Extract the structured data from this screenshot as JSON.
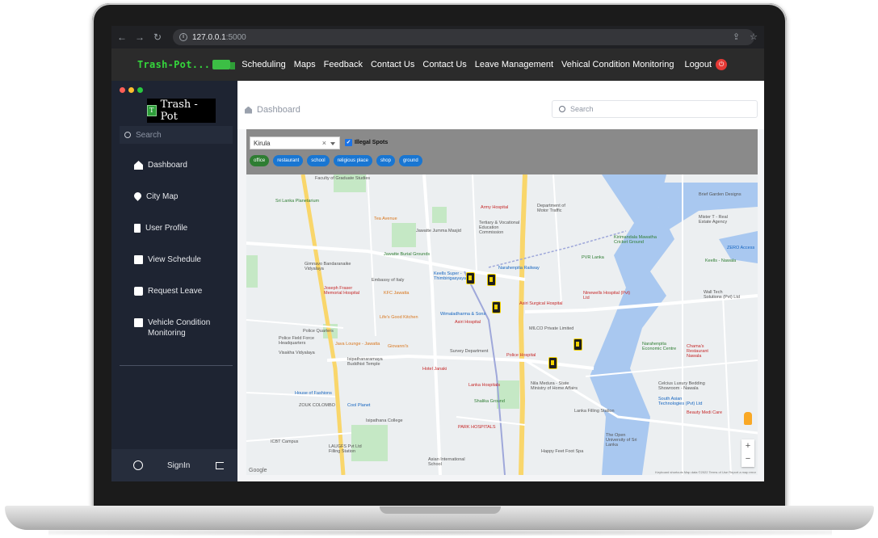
{
  "browser": {
    "url_host": "127.0.0.1",
    "url_port": ":5000"
  },
  "topnav": {
    "brand": "Trash-Pot...",
    "items": [
      "Scheduling",
      "Maps",
      "Feedback",
      "Contact Us",
      "Contact Us",
      "Leave Management",
      "Vehical Condition Monitoring"
    ],
    "logout": "Logout"
  },
  "sidebar": {
    "logo_text": "Trash - Pot",
    "search_placeholder": "Search",
    "items": [
      {
        "label": "Dashboard",
        "icon": "home-icon"
      },
      {
        "label": "City Map",
        "icon": "map-pin-icon"
      },
      {
        "label": "User Profile",
        "icon": "bin-icon"
      },
      {
        "label": "View Schedule",
        "icon": "calendar-icon"
      },
      {
        "label": "Request Leave",
        "icon": "request-icon"
      },
      {
        "label": "Vehicle Condition Monitoring",
        "icon": "vehicle-icon"
      }
    ],
    "signin": "SignIn"
  },
  "main": {
    "breadcrumb": "Dashboard",
    "search_placeholder": "Search",
    "filter": {
      "selected_area": "Kirula",
      "illegal_spots_label": "Illegal Spots",
      "chips": [
        "office",
        "restaurant",
        "school",
        "religious place",
        "shop",
        "ground"
      ]
    }
  },
  "map": {
    "labels": [
      "Faculty of Graduate Studies",
      "Sri Lanka Planetarium",
      "Tea Avenue",
      "Army Hospital",
      "Department of Motor Traffic",
      "Tertiary & Vocational Education Commission",
      "Jawatte Jumma Masjid",
      "Jawatte Burial Grounds",
      "Gimnavo Bandaranaike Vidyalaya",
      "Embassy of Italy",
      "Keells Super - Thimbirigasyaya",
      "Narahenpita Railway",
      "PVR Lanka",
      "Kirimandala Mawatha Cricket Ground",
      "Joseph Fraser Memorial Hospital",
      "KFC Jawatta",
      "Life's Good Kitchen",
      "Wimaladharma & Sons",
      "Asiri Surgical Hospital",
      "Ninewells Hospital (Pvt) Ltd",
      "Asiri Hospital",
      "MILCO Private Limited",
      "Police Quarters",
      "Police Field Force Headquarters",
      "Visakha Vidyalaya",
      "Java Lounge - Jawatta",
      "Giovanni's",
      "Survey Department",
      "Police Hospital",
      "Narahenpita Economic Centre",
      "Isipathanaramaya Buddhist Temple",
      "Hotel Janaki",
      "Lanka Hospitals",
      "Nila Medura - State Ministry of Home Affairs",
      "House of Fashions",
      "Cool Planet",
      "Isipathana College",
      "PARK HOSPITALS",
      "ZOUK COLOMBO",
      "Shalika Ground",
      "Lanka Filling Station",
      "Celcius Luxury Bedding Showroom - Nawala",
      "South Asian Technologies (Pvt) Ltd",
      "Beauty Medi Care",
      "The Open University of Sri Lanka",
      "Happy Feet Foot Spa",
      "Asian International School",
      "LAUGFS Pvt Ltd Filling Station",
      "ICBT Campus",
      "Chama's Restaurant Nawala",
      "Mister T - Real Estate Agency",
      "Keells - Nawala",
      "Wall Tech Solutions (Pvt) Ltd",
      "ZERO Access",
      "Brief Garden Designs"
    ],
    "zoom_in": "+",
    "zoom_out": "−",
    "google": "Google",
    "attribution": "Keyboard shortcuts   Map data ©2022   Terms of Use   Report a map error"
  }
}
